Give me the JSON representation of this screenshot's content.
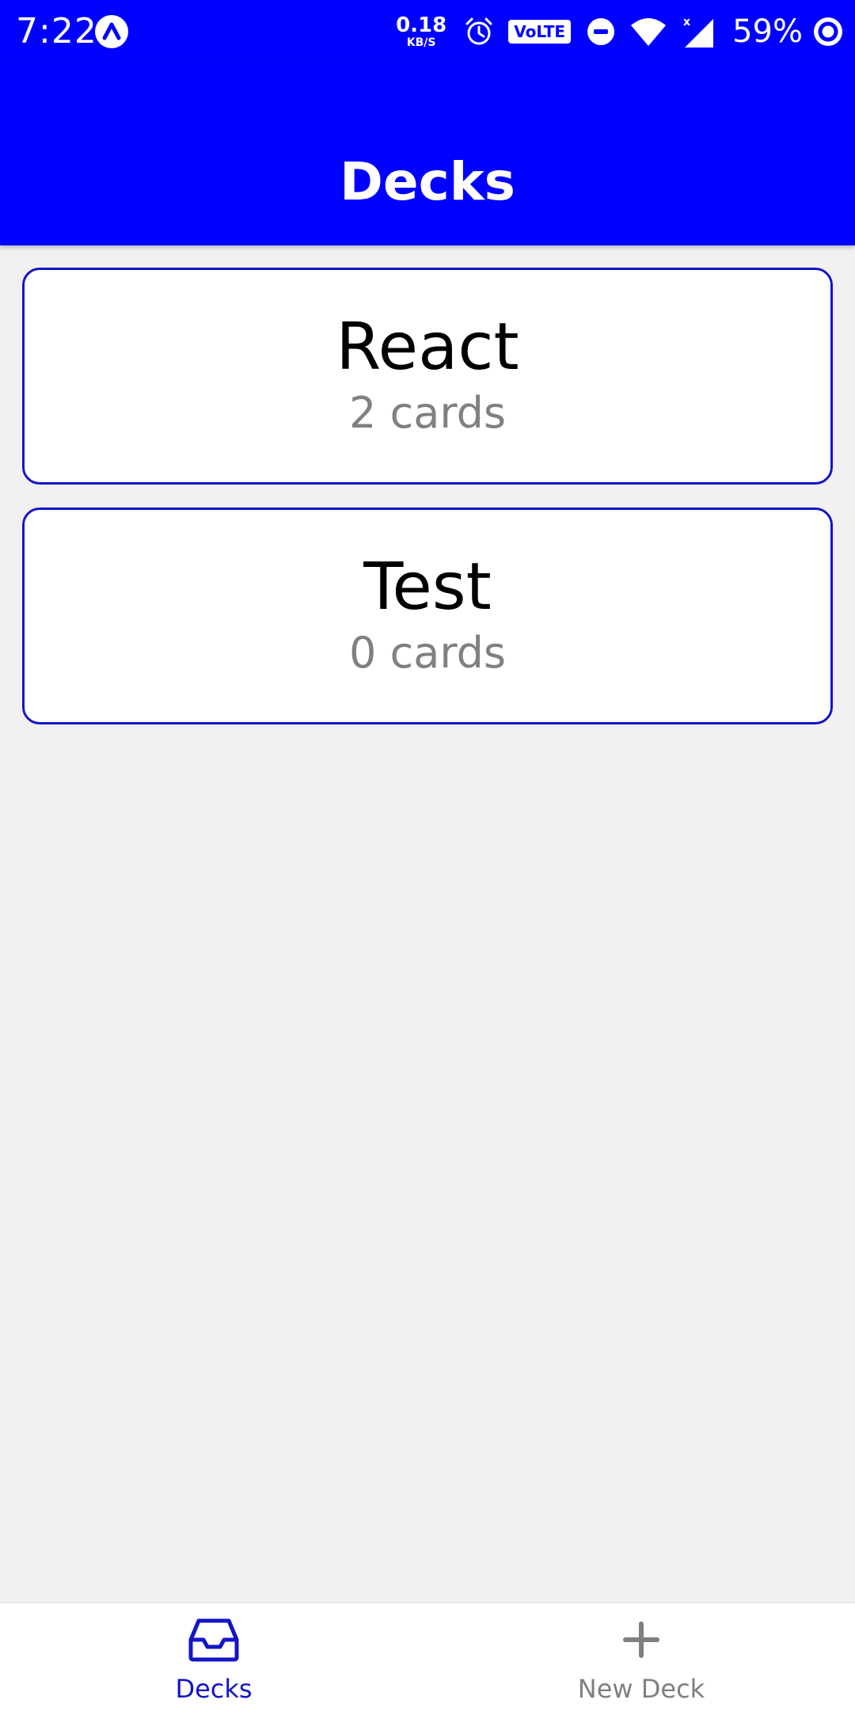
{
  "status_bar": {
    "time": "7:22",
    "net_speed_value": "0.18",
    "net_speed_unit": "KB/S",
    "volte": "VoLTE",
    "battery_percent": "59%",
    "icons": [
      "app-notification-icon",
      "alarm-icon",
      "volte-icon",
      "dnd-icon",
      "wifi-icon",
      "cellular-signal-icon",
      "battery-icon"
    ]
  },
  "header": {
    "title": "Decks"
  },
  "decks": [
    {
      "title": "React",
      "count": "2 cards"
    },
    {
      "title": "Test",
      "count": "0 cards"
    }
  ],
  "tab_bar": {
    "decks_label": "Decks",
    "new_deck_label": "New Deck",
    "active_tab": "Decks"
  },
  "colors": {
    "primary": "#0000ff",
    "card_border": "#1414c8",
    "background": "#f1f1f1",
    "muted_text": "#808080"
  }
}
